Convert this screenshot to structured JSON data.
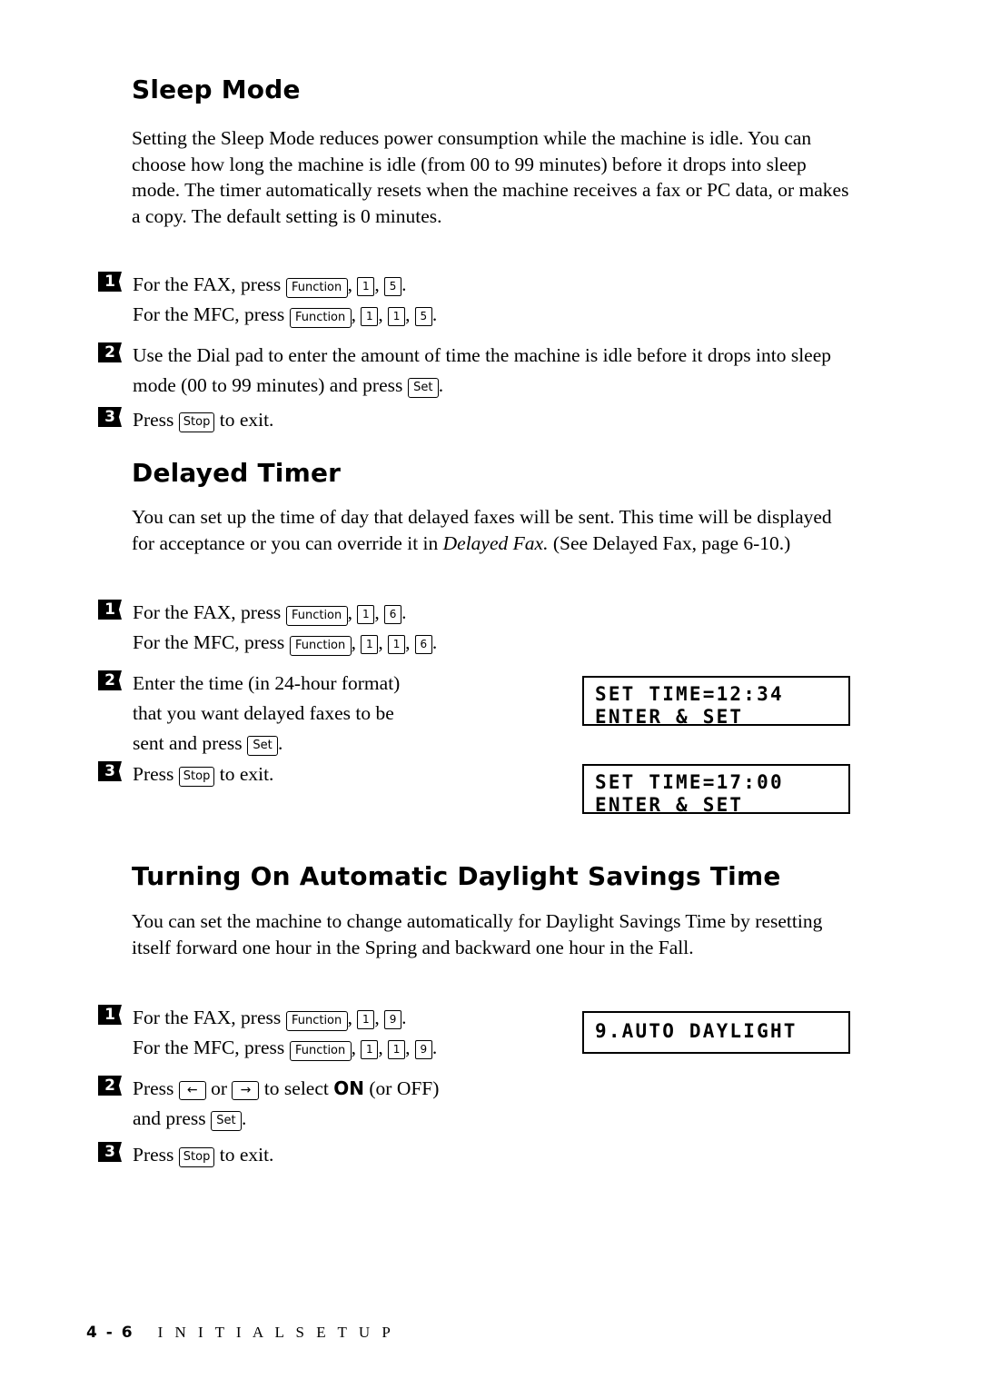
{
  "sections": [
    {
      "title": "Sleep Mode",
      "paragraph": "Setting the Sleep Mode reduces power consumption while the machine is idle.  You can choose how long the machine is idle (from 00 to 99 minutes) before it drops into sleep mode.  The timer automatically resets when the machine receives a fax or PC data, or makes a copy. The default setting is 0 minutes.",
      "steps": [
        {
          "num": "1",
          "line1_pre": "For the FAX, press ",
          "line1_keys": [
            "Function",
            "1",
            "5"
          ],
          "line1_post": ".",
          "line2_pre": "For the MFC, press ",
          "line2_keys": [
            "Function",
            "1",
            "1",
            "5"
          ],
          "line2_post": "."
        },
        {
          "num": "2",
          "text_pre": "Use the Dial pad to enter the amount of time the machine is idle before it drops into sleep mode (00 to 99 minutes) and press ",
          "key": "Set",
          "text_post": "."
        },
        {
          "num": "3",
          "text_pre": "Press ",
          "key": "Stop",
          "text_post": " to exit."
        }
      ]
    },
    {
      "title": "Delayed Timer",
      "paragraph_part1": "You can set up the time of day that delayed faxes will be sent. This time will be displayed for acceptance or you can override it in ",
      "paragraph_italic": "Delayed Fax.",
      "paragraph_part2": " (See Delayed Fax, page 6-10.)",
      "steps": [
        {
          "num": "1",
          "line1_pre": "For the FAX, press ",
          "line1_keys": [
            "Function",
            "1",
            "6"
          ],
          "line1_post": ".",
          "line2_pre": "For the MFC, press ",
          "line2_keys": [
            "Function",
            "1",
            "1",
            "6"
          ],
          "line2_post": "."
        },
        {
          "num": "2",
          "line1": "Enter the time (in 24-hour format)",
          "line2": "that you want delayed faxes to be",
          "line3_pre": "sent and press ",
          "key": "Set",
          "line3_post": "."
        },
        {
          "num": "3",
          "text_pre": "Press ",
          "key": "Stop",
          "text_post": " to exit."
        }
      ],
      "lcd_displays": [
        {
          "line1": "SET TIME=12:34",
          "line2": "ENTER & SET"
        },
        {
          "line1": "SET TIME=17:00",
          "line2": "ENTER & SET"
        }
      ]
    },
    {
      "title": "Turning On Automatic Daylight Savings Time",
      "paragraph": "You can set the machine to change automatically for Daylight Savings Time by resetting itself forward one hour in the Spring and backward one hour in the Fall.",
      "steps": [
        {
          "num": "1",
          "line1_pre": "For the FAX, press ",
          "line1_keys": [
            "Function",
            "1",
            "9"
          ],
          "line1_post": ".",
          "line2_pre": "For the MFC, press ",
          "line2_keys": [
            "Function",
            "1",
            "1",
            "9"
          ],
          "line2_post": "."
        },
        {
          "num": "2",
          "line1_pre": "Press ",
          "key_left": "←",
          "line1_mid": " or ",
          "key_right": "→",
          "line1_post": " to select ",
          "bold_on": "ON",
          "line1_tail": " (or OFF)",
          "line2_pre": "and press ",
          "key_set": "Set",
          "line2_post": "."
        },
        {
          "num": "3",
          "text_pre": "Press ",
          "key": "Stop",
          "text_post": " to exit."
        }
      ],
      "lcd_displays": [
        {
          "line1": "9.AUTO DAYLIGHT"
        }
      ]
    }
  ],
  "footer": {
    "page_number": "4 - 6",
    "chapter": "I N I T I A L   S E T U P"
  }
}
